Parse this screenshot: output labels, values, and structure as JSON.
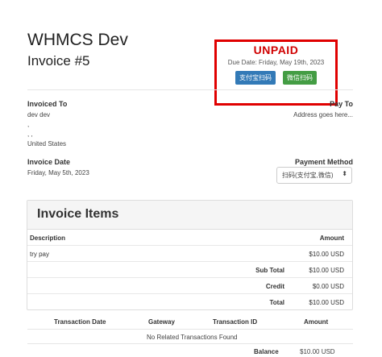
{
  "header": {
    "company": "WHMCS Dev",
    "invoice_number": "Invoice #5"
  },
  "status": {
    "label": "UNPAID",
    "due_date": "Due Date: Friday, May 19th, 2023",
    "alipay_button": "支付宝扫码",
    "wechat_button": "微信扫码",
    "border_color": "#e00000"
  },
  "invoiced_to": {
    "label": "Invoiced To",
    "name": "dev dev",
    "line2": ",",
    "line3": ", ,",
    "country": "United States"
  },
  "pay_to": {
    "label": "Pay To",
    "address": "Address goes here..."
  },
  "invoice_date": {
    "label": "Invoice Date",
    "value": "Friday, May 5th, 2023"
  },
  "payment_method": {
    "label": "Payment Method",
    "selected": "扫码(支付宝,微信)"
  },
  "items": {
    "title": "Invoice Items",
    "col_description": "Description",
    "col_amount": "Amount",
    "rows": [
      {
        "description": "try pay",
        "amount": "$10.00 USD"
      }
    ],
    "subtotal_label": "Sub Total",
    "subtotal": "$10.00 USD",
    "credit_label": "Credit",
    "credit": "$0.00 USD",
    "total_label": "Total",
    "total": "$10.00 USD"
  },
  "transactions": {
    "col_date": "Transaction Date",
    "col_gateway": "Gateway",
    "col_id": "Transaction ID",
    "col_amount": "Amount",
    "empty": "No Related Transactions Found",
    "balance_label": "Balance",
    "balance": "$10.00 USD"
  }
}
